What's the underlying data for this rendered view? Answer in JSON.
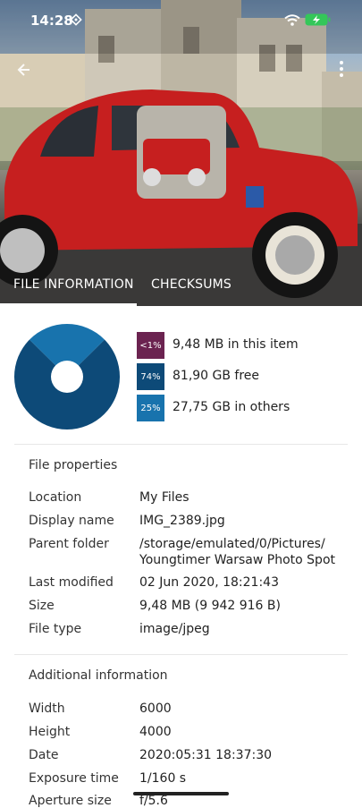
{
  "status_bar": {
    "time": "14:28",
    "icons": [
      "screen-rotation-icon",
      "wifi-icon",
      "battery-charging-icon"
    ],
    "battery_color": "#34c759"
  },
  "header": {
    "image_description_icon": "photo-thumbnail",
    "back_icon": "back-arrow-icon",
    "menu_icon": "more-vertical-icon"
  },
  "tabs": [
    {
      "label": "FILE INFORMATION",
      "selected": true
    },
    {
      "label": "CHECKSUMS",
      "selected": false
    }
  ],
  "usage": {
    "chart_data": {
      "type": "pie",
      "slices": [
        {
          "label": "9,48 MB in this item",
          "percent_label": "<1%",
          "value": 0.0001,
          "color": "#6b2350"
        },
        {
          "label": "81,90 GB free",
          "percent_label": "74%",
          "value": 74,
          "color": "#0d4a78"
        },
        {
          "label": "27,75 GB in others",
          "percent_label": "25%",
          "value": 25,
          "color": "#1873ad"
        }
      ]
    }
  },
  "file_properties": {
    "title": "File properties",
    "rows": [
      {
        "key": "Location",
        "value": "My Files"
      },
      {
        "key": "Display name",
        "value": "IMG_2389.jpg"
      },
      {
        "key": "Parent folder",
        "value": "/storage/emulated/0/Pictures/",
        "value2": "Youngtimer Warsaw Photo Spot"
      },
      {
        "key": "Last modified",
        "value": "02 Jun 2020, 18:21:43"
      },
      {
        "key": "Size",
        "value": "9,48 MB (9 942 916 B)"
      },
      {
        "key": "File type",
        "value": "image/jpeg"
      }
    ]
  },
  "additional_info": {
    "title": "Additional information",
    "rows": [
      {
        "key": "Width",
        "value": "6000"
      },
      {
        "key": "Height",
        "value": "4000"
      },
      {
        "key": "Date",
        "value": "2020:05:31 18:37:30"
      },
      {
        "key": "Exposure time",
        "value": "1/160 s"
      },
      {
        "key": "Aperture size",
        "value": "f/5.6"
      }
    ]
  }
}
